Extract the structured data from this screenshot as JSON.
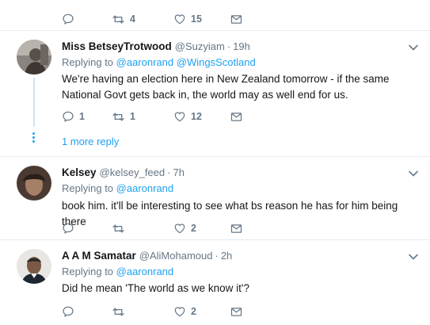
{
  "top_actions": {
    "reply_count": "",
    "retweet_count": "4",
    "like_count": "15"
  },
  "tweets": [
    {
      "name": "Miss BetseyTrotwood",
      "handle": "@Suzyiam",
      "time": "19h",
      "replying_prefix": "Replying to",
      "mentions": [
        "@aaronrand",
        "@WingsScotland"
      ],
      "text": "We're having an election here in New Zealand tomorrow - if the same National Govt gets back in, the world may as well end for us.",
      "reply_count": "1",
      "retweet_count": "1",
      "like_count": "12"
    },
    {
      "name": "Kelsey",
      "handle": "@kelsey_feed",
      "time": "7h",
      "replying_prefix": "Replying to",
      "mentions": [
        "@aaronrand"
      ],
      "text": "book him. it'll be interesting to see what bs reason he has for him being there",
      "reply_count": "",
      "retweet_count": "",
      "like_count": "2"
    },
    {
      "name": "A A M Samatar",
      "handle": "@AliMohamoud",
      "time": "2h",
      "replying_prefix": "Replying to",
      "mentions": [
        "@aaronrand"
      ],
      "text": "Did he mean 'The world as we know it'?",
      "reply_count": "",
      "retweet_count": "",
      "like_count": "2"
    }
  ],
  "more_replies_label": "1 more reply",
  "time_separator": "·",
  "icons": {
    "reply": "reply-icon",
    "retweet": "retweet-icon",
    "like": "heart-icon",
    "message": "envelope-icon",
    "caret": "chevron-down-icon"
  },
  "colors": {
    "accent": "#1da1f2",
    "secondary_text": "#657786",
    "primary_text": "#14171a",
    "divider": "#e6ecf0"
  }
}
